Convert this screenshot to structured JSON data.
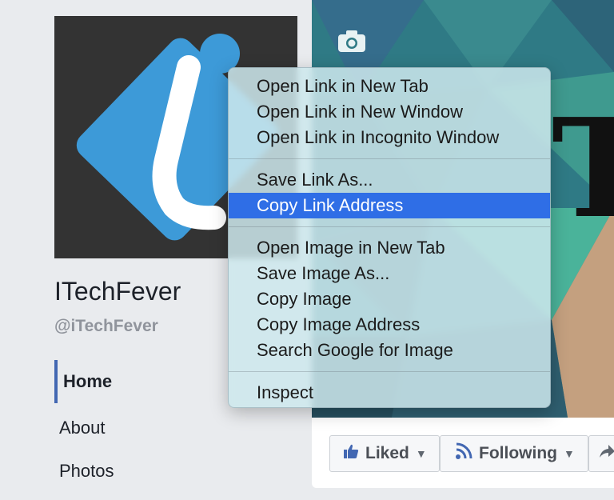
{
  "profile": {
    "name": "ITechFever",
    "handle": "@iTechFever"
  },
  "nav": {
    "items": [
      {
        "label": "Home",
        "active": true
      },
      {
        "label": "About",
        "active": false
      },
      {
        "label": "Photos",
        "active": false
      }
    ]
  },
  "actions": {
    "liked_label": "Liked",
    "following_label": "Following"
  },
  "context_menu": {
    "group1": [
      "Open Link in New Tab",
      "Open Link in New Window",
      "Open Link in Incognito Window"
    ],
    "group2": [
      "Save Link As...",
      "Copy Link Address"
    ],
    "group3": [
      "Open Image in New Tab",
      "Save Image As...",
      "Copy Image",
      "Copy Image Address",
      "Search Google for Image"
    ],
    "group4": [
      "Inspect"
    ],
    "highlighted": "Copy Link Address"
  },
  "colors": {
    "accent": "#2f6ee6",
    "nav_active_border": "#4267b2",
    "logo_blue": "#3d9ad8"
  },
  "icons": {
    "camera": "camera-icon",
    "thumbs_up": "thumbs-up-icon",
    "rss": "rss-icon",
    "share": "share-icon",
    "caret": "caret-down-icon"
  }
}
